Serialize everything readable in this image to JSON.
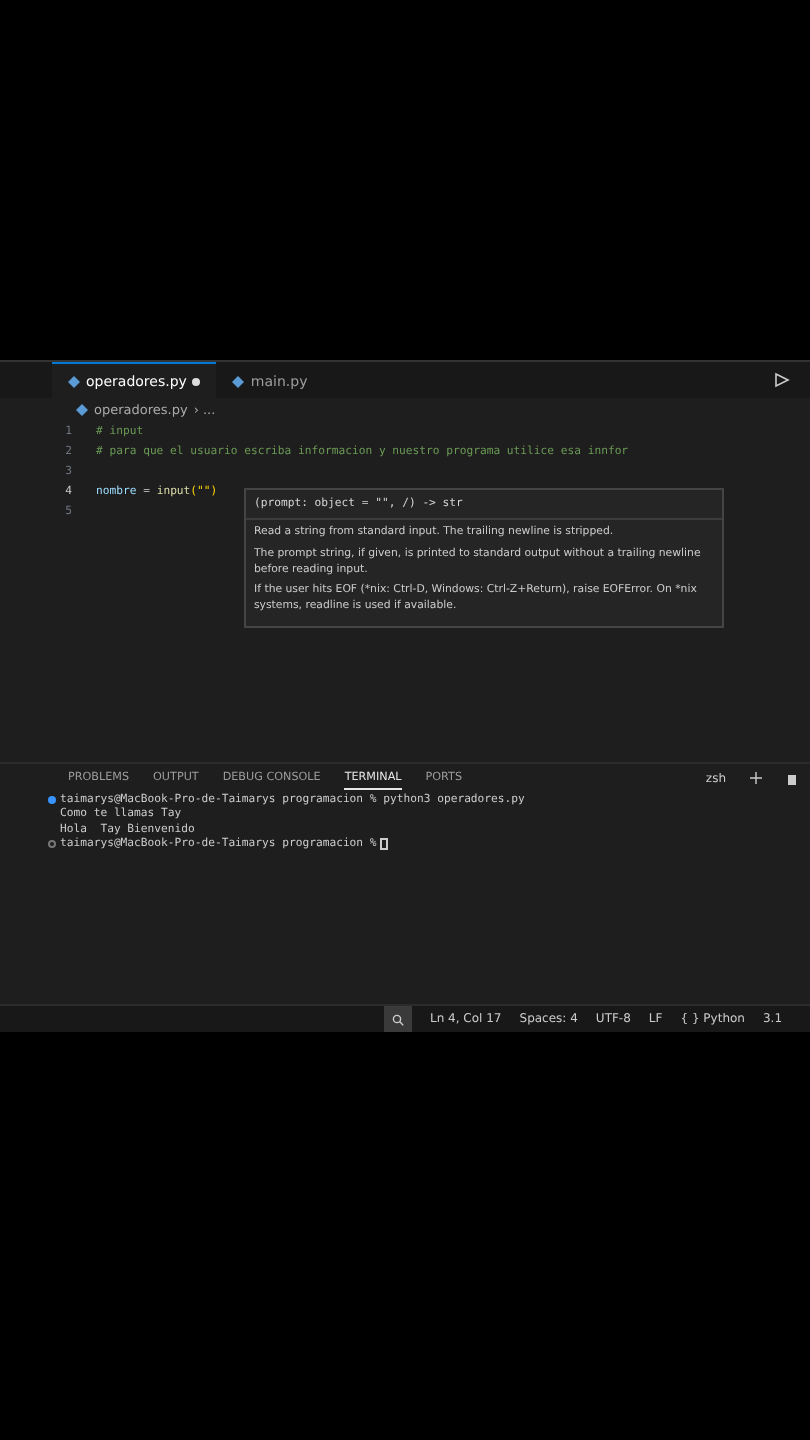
{
  "tabs": [
    {
      "label": "operadores.py",
      "selected": true,
      "modified": true
    },
    {
      "label": "main.py",
      "selected": false,
      "modified": false
    }
  ],
  "breadcrumb": {
    "file": "operadores.py",
    "rest": "› ..."
  },
  "code_lines": [
    {
      "number": "1",
      "tokens": [
        {
          "text": "# input",
          "kind": "comment"
        }
      ]
    },
    {
      "number": "2",
      "tokens": [
        {
          "text": "# para que el usuario escriba informacion y nuestro programa utilice esa innfor",
          "kind": "comment"
        }
      ]
    },
    {
      "number": "3"
    },
    {
      "number": "4",
      "current": true,
      "tokens": [
        {
          "text": "nombre",
          "kind": "variable"
        },
        {
          "text": " = ",
          "kind": "plain"
        },
        {
          "text": "input",
          "kind": "function"
        },
        {
          "text": "(\"\")",
          "kind": "bracket"
        }
      ]
    },
    {
      "number": "5"
    }
  ],
  "hover": {
    "signature": "(prompt: object = \"\", /) -> str",
    "paragraphs": [
      "Read a string from standard input. The trailing newline is stripped.",
      "The prompt string, if given, is printed to standard output without a trailing newline before reading input.",
      "If the user hits EOF (*nix: Ctrl-D, Windows: Ctrl-Z+Return), raise EOFError. On *nix systems, readline is used if available."
    ]
  },
  "panel_tabs": [
    {
      "label": "PROBLEMS",
      "selected": false
    },
    {
      "label": "OUTPUT",
      "selected": false
    },
    {
      "label": "DEBUG CONSOLE",
      "selected": false
    },
    {
      "label": "TERMINAL",
      "selected": true
    },
    {
      "label": "PORTS",
      "selected": false
    }
  ],
  "terminal_shell": "zsh",
  "terminal_lines": [
    {
      "kind": "prompt-done",
      "text": "taimarys@MacBook-Pro-de-Taimarys programacion % python3 operadores.py"
    },
    {
      "kind": "output",
      "text": "Como te llamas Tay"
    },
    {
      "kind": "output",
      "text": "Hola  Tay Bienvenido"
    },
    {
      "kind": "prompt-active",
      "text": "taimarys@MacBook-Pro-de-Taimarys programacion %"
    }
  ],
  "status_items": [
    "Ln 4, Col 17",
    "Spaces: 4",
    "UTF-8",
    "LF",
    "{ } Python",
    "3.1"
  ]
}
